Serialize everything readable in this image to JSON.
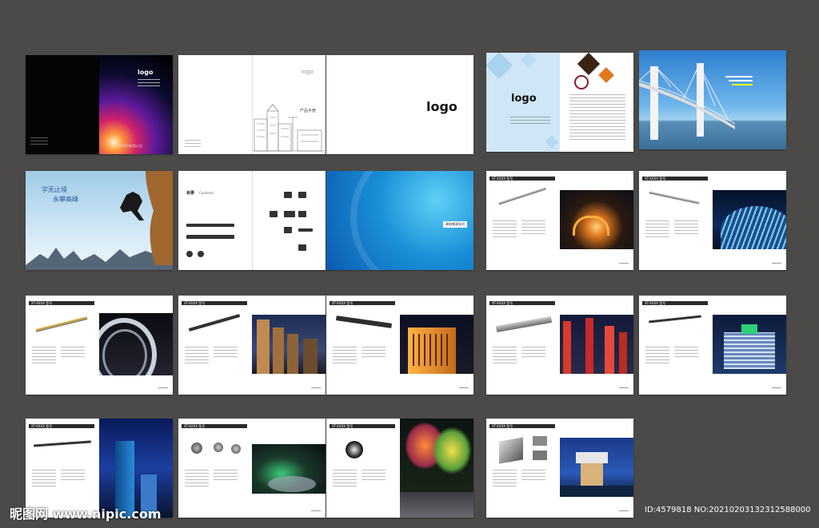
{
  "canvas": {
    "background": "#4b4a48"
  },
  "brochure": {
    "cover": {
      "logo": "logo",
      "company": "XXXXX有限公司"
    },
    "toc": {
      "logo": "logo",
      "title": "产品手册"
    },
    "blank_logo": "logo",
    "intro": {
      "logo": "logo"
    },
    "slogan": {
      "line1": "学无止境",
      "line2": "永攀高峰"
    },
    "catalog": {
      "title": "目录",
      "subtitle": "Contents"
    },
    "product_series": "建筑景观系列",
    "spec_label": "技术参数",
    "product_header": "XT-XXXX 型号"
  },
  "watermark": {
    "site": "昵图网 www.nipic.com",
    "id_text": "ID:4579818 NO:20210203132312588000"
  },
  "colors": {
    "dark_header": "#2b2b2b",
    "brand_blue": "#1a8fd8",
    "accent_orange": "#e0781e"
  }
}
